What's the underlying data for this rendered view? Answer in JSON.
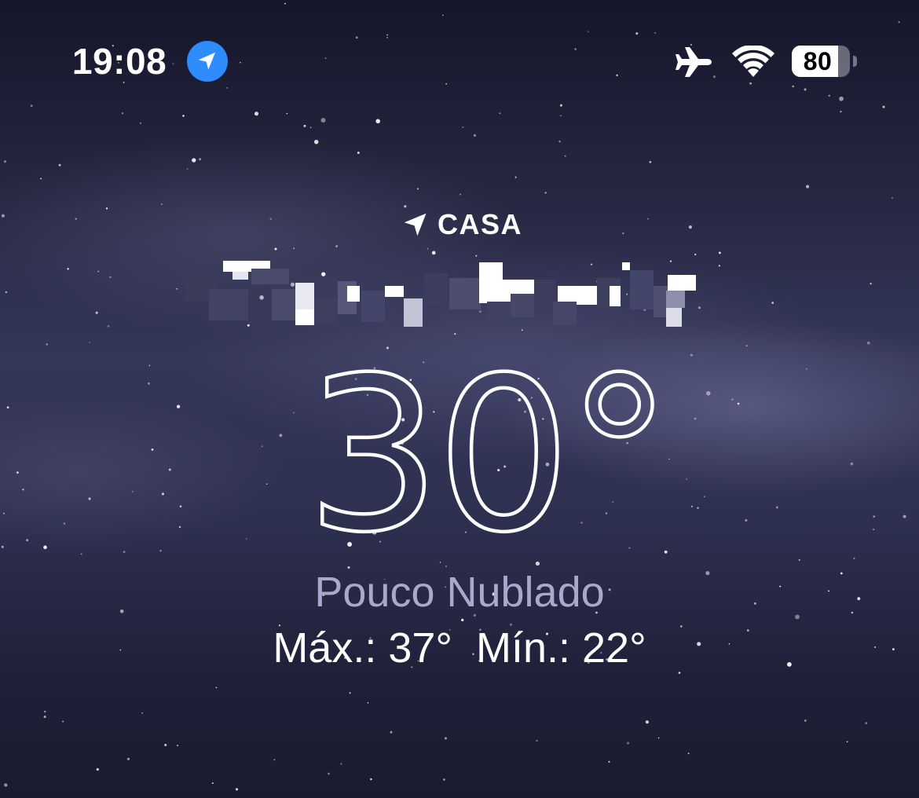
{
  "status_bar": {
    "time": "19:08",
    "battery_percent": "80",
    "battery_level": 0.8,
    "icons": [
      "location-icon",
      "airplane-mode-icon",
      "wifi-icon",
      "battery-icon"
    ]
  },
  "weather": {
    "location_label": "CASA",
    "city_name_redacted": true,
    "temperature": "30°",
    "condition": "Pouco Nublado",
    "high_label": "Máx.: 37°",
    "low_label": "Mín.: 22°"
  },
  "colors": {
    "location_badge": "#2f8cff",
    "condition_text": "#a9a9cc",
    "sky_top": "#15162b",
    "sky_mid": "#35375a"
  }
}
